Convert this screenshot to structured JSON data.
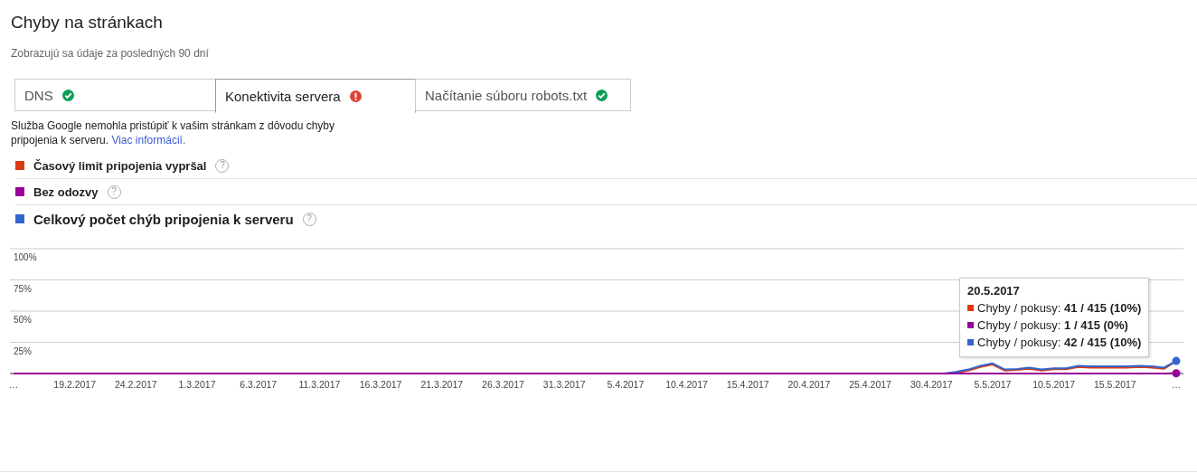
{
  "page": {
    "title": "Chyby na stránkach",
    "subtitle": "Zobrazujú sa údaje za posledných 90 dní"
  },
  "tabs": [
    {
      "label": "DNS",
      "kind": "ok",
      "selected": false
    },
    {
      "label": "Konektivita servera",
      "kind": "error",
      "selected": true
    },
    {
      "label": "Načítanie súboru robots.txt",
      "kind": "ok",
      "selected": false
    }
  ],
  "message": {
    "text": "Služba Google nemohla pristúpiť k vašim stránkam z dôvodu chyby pripojenia k serveru.",
    "link": "Viac informácií."
  },
  "legend": [
    {
      "label": "Časový limit pripojenia vypršal",
      "color": "#dc3912",
      "kind": "series",
      "help": "?"
    },
    {
      "label": "Bez odozvy",
      "color": "#990099",
      "kind": "series",
      "help": "?"
    },
    {
      "label": "Celkový počet chýb pripojenia k serveru",
      "color": "#3366cc",
      "kind": "total",
      "help": "?"
    }
  ],
  "chart_data": {
    "type": "line",
    "categories": [
      "…",
      null,
      null,
      null,
      null,
      "19.2.2017",
      null,
      null,
      null,
      null,
      "24.2.2017",
      null,
      null,
      null,
      null,
      "1.3.2017",
      null,
      null,
      null,
      null,
      "6.3.2017",
      null,
      null,
      null,
      null,
      "11.3.2017",
      null,
      null,
      null,
      null,
      "16.3.2017",
      null,
      null,
      null,
      null,
      "21.3.2017",
      null,
      null,
      null,
      null,
      "26.3.2017",
      null,
      null,
      null,
      null,
      "31.3.2017",
      null,
      null,
      null,
      null,
      "5.4.2017",
      null,
      null,
      null,
      null,
      "10.4.2017",
      null,
      null,
      null,
      null,
      "15.4.2017",
      null,
      null,
      null,
      null,
      "20.4.2017",
      null,
      null,
      null,
      null,
      "25.4.2017",
      null,
      null,
      null,
      null,
      "30.4.2017",
      null,
      null,
      null,
      null,
      "5.5.2017",
      null,
      null,
      null,
      null,
      "10.5.2017",
      null,
      null,
      null,
      null,
      "15.5.2017",
      null,
      null,
      null,
      null,
      "…"
    ],
    "series": [
      {
        "color": "#dc3912",
        "values": [
          null,
          null,
          null,
          null,
          null,
          null,
          null,
          null,
          null,
          null,
          null,
          null,
          null,
          null,
          null,
          null,
          null,
          null,
          null,
          null,
          null,
          null,
          null,
          null,
          null,
          null,
          null,
          null,
          null,
          null,
          null,
          null,
          null,
          null,
          null,
          null,
          null,
          null,
          null,
          null,
          null,
          null,
          null,
          null,
          null,
          null,
          null,
          null,
          null,
          null,
          null,
          null,
          null,
          null,
          null,
          null,
          null,
          null,
          null,
          null,
          null,
          null,
          null,
          null,
          null,
          null,
          null,
          null,
          null,
          null,
          null,
          null,
          null,
          null,
          null,
          null,
          null,
          0.6,
          2.4,
          5.2,
          7.2,
          2.4,
          2.9,
          3.8,
          2.4,
          3.4,
          3.4,
          5.3,
          4.8,
          4.8,
          4.8,
          4.8,
          5.3,
          4.8,
          3.9,
          9.9
        ]
      },
      {
        "color": "#990099",
        "values": [
          0,
          0,
          0,
          0,
          0,
          0,
          0,
          0,
          0,
          0,
          0,
          0,
          0,
          0,
          0,
          0,
          0,
          0,
          0,
          0,
          0,
          0,
          0,
          0,
          0,
          0,
          0,
          0,
          0,
          0,
          0,
          0,
          0,
          0,
          0,
          0,
          0,
          0,
          0,
          0,
          0,
          0,
          0,
          0,
          0,
          0,
          0,
          0,
          0,
          0,
          0,
          0,
          0,
          0,
          0,
          0,
          0,
          0,
          0,
          0,
          0,
          0,
          0,
          0,
          0,
          0,
          0,
          0,
          0,
          0,
          0,
          0,
          0,
          0,
          0,
          0,
          0,
          0,
          0,
          0,
          0,
          0,
          0,
          0,
          0,
          0,
          0,
          0,
          0,
          0,
          0,
          0,
          0,
          0,
          0,
          0.2
        ]
      },
      {
        "color": "#3366cc",
        "values": [
          null,
          null,
          null,
          null,
          null,
          null,
          null,
          null,
          null,
          null,
          null,
          null,
          null,
          null,
          null,
          null,
          null,
          null,
          null,
          null,
          null,
          null,
          null,
          null,
          null,
          null,
          null,
          null,
          null,
          null,
          null,
          null,
          null,
          null,
          null,
          null,
          null,
          null,
          null,
          null,
          null,
          null,
          null,
          null,
          null,
          null,
          null,
          null,
          null,
          null,
          null,
          null,
          null,
          null,
          null,
          null,
          null,
          null,
          null,
          null,
          null,
          null,
          null,
          null,
          null,
          null,
          null,
          null,
          null,
          null,
          null,
          null,
          null,
          null,
          null,
          null,
          0,
          1.2,
          3.2,
          6.2,
          8.2,
          3.2,
          3.7,
          4.7,
          3.2,
          4.2,
          4.2,
          6.2,
          5.7,
          5.7,
          5.7,
          5.7,
          6.2,
          5.7,
          4.7,
          10.1
        ]
      }
    ],
    "grid": true,
    "ylim": [
      0,
      100
    ],
    "yticks": [
      {
        "value": 25,
        "label": "25%"
      },
      {
        "value": 50,
        "label": "50%"
      },
      {
        "value": 75,
        "label": "75%"
      },
      {
        "value": 100,
        "label": "100%"
      }
    ]
  },
  "tooltip": {
    "date": "20.5.2017",
    "rows": [
      {
        "text": "Chyby / pokusy: **41 / 415 (10%)**",
        "color": "#dc3912"
      },
      {
        "text": "Chyby / pokusy: **1 / 415 (0%)**",
        "color": "#990099"
      },
      {
        "text": "Chyby / pokusy: **42 / 415 (10%)**",
        "color": "#3366cc"
      }
    ]
  }
}
